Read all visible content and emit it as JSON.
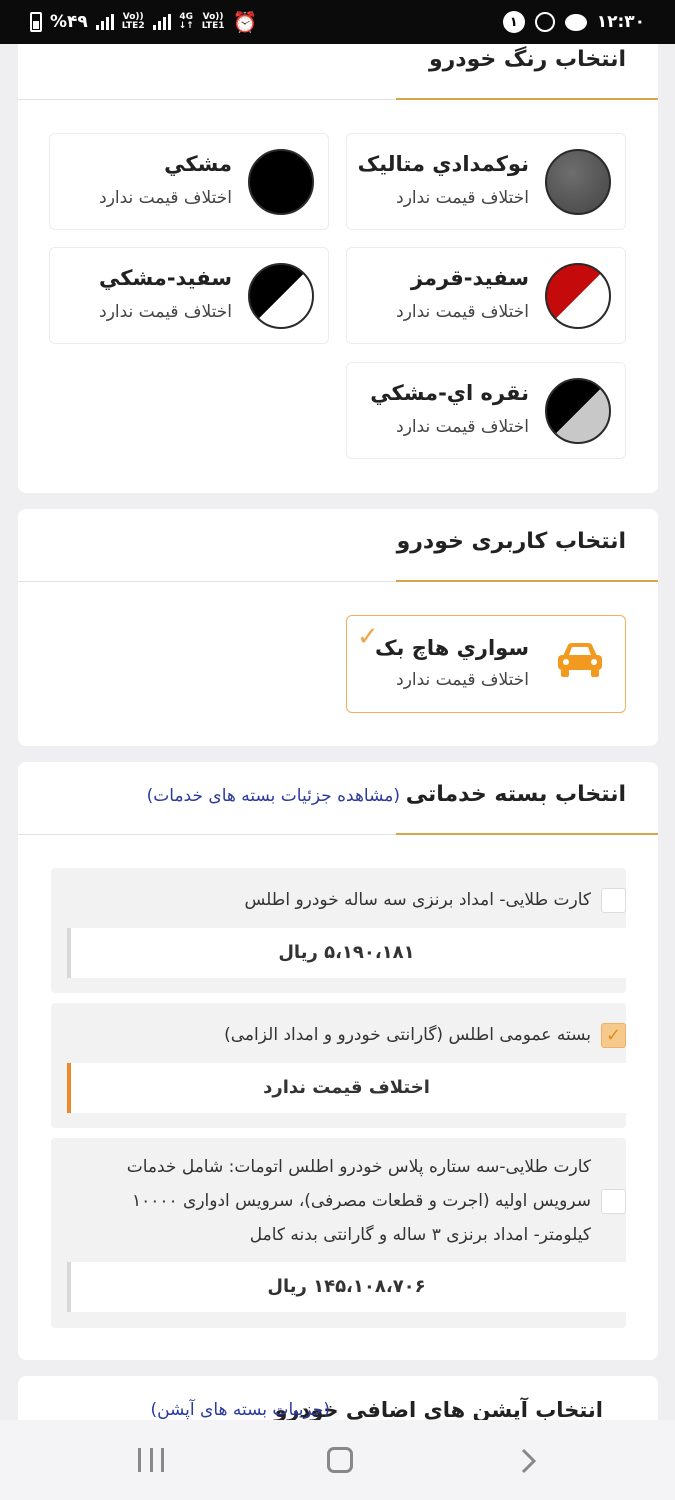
{
  "status_bar": {
    "battery": "%۴۹",
    "lte2": "LTE2",
    "lte1": "LTE1",
    "net_4g": "4G",
    "volte": "Vo))",
    "notification_count": "۱",
    "time": "۱۲:۳۰"
  },
  "color_section": {
    "title": "انتخاب رنگ خودرو",
    "options": [
      {
        "name": "نوکمدادي متاليک",
        "price": "اختلاف قيمت ندارد",
        "color": "#5a5a5a"
      },
      {
        "name": "مشکي",
        "price": "اختلاف قيمت ندارد",
        "color": "#000000"
      },
      {
        "name": "سفيد-قرمز",
        "price": "اختلاف قيمت ندارد",
        "color": "#c40a0a"
      },
      {
        "name": "سفيد-مشکي",
        "price": "اختلاف قيمت ندارد",
        "color": "#000000"
      },
      {
        "name": "نقره اي-مشکي",
        "price": "اختلاف قيمت ندارد",
        "color": "#c8c8c8"
      }
    ]
  },
  "usage_section": {
    "title": "انتخاب کاربری خودرو",
    "option": {
      "name": "سواري هاچ بک",
      "price": "اختلاف قيمت ندارد",
      "icon": "car-icon",
      "check": "✓",
      "accent": "#f29a1f"
    }
  },
  "service_section": {
    "title": "انتخاب بسته خدماتی",
    "link": "(مشاهده جزئیات بسته های خدمات)",
    "packages": [
      {
        "label": "کارت طلایی- امداد برنزی سه ساله خودرو اطلس",
        "price": "۵،۱۹۰،۱۸۱ ریال",
        "checked": false
      },
      {
        "label": "بسته عمومی اطلس (گارانتی خودرو و امداد الزامی)",
        "price": "اختلاف قیمت ندارد",
        "checked": true,
        "check": "✓"
      },
      {
        "label_lines": [
          "کارت طلایی-سه ستاره پلاس خودرو اطلس اتومات: شامل خدمات",
          "سرویس اولیه (اجرت و قطعات مصرفی)، سرویس ادواری ۱۰۰۰۰",
          "کیلومتر- امداد برنزی ۳ ساله و گارانتی بدنه کامل"
        ],
        "price": "۱۴۵،۱۰۸،۷۰۶ ریال",
        "checked": false
      }
    ]
  },
  "options_section": {
    "title": "انتخاب آپشن های اضافی خودرو",
    "link": "(جزییات بسته های آپشن)"
  },
  "colors": {
    "accent": "#d6a64b",
    "link": "#2b3a9e",
    "orange": "#e98b2a"
  }
}
